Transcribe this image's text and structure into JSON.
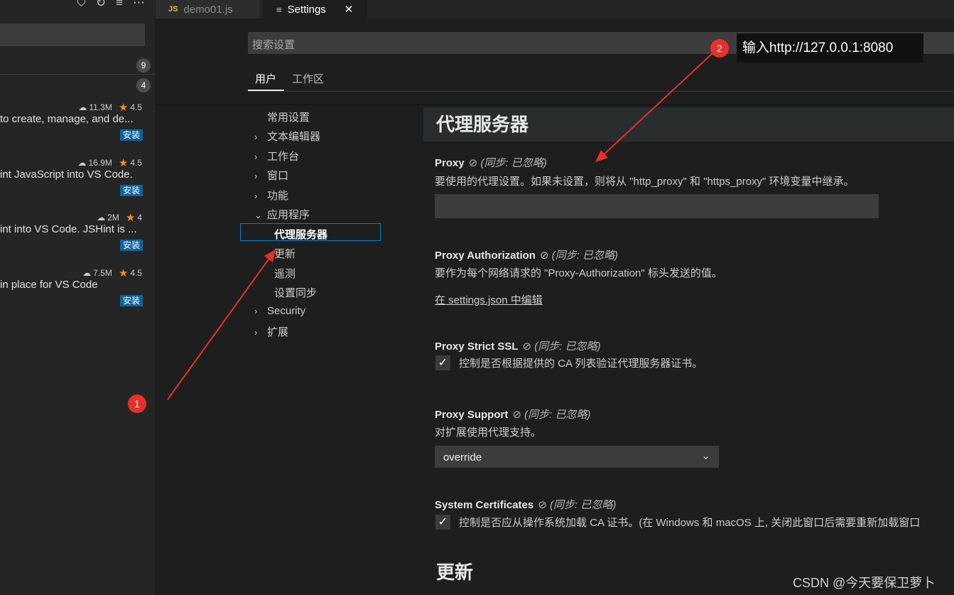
{
  "tabs": [
    {
      "label": "demo01.js",
      "icon": "js-icon",
      "icon_text": "JS"
    },
    {
      "label": "Settings",
      "icon": "settings-doc-icon",
      "close": "✕"
    }
  ],
  "sidebar": {
    "view_count_1": "9",
    "view_count_2": "4",
    "extensions": [
      {
        "downloads": "11.3M",
        "rating": "4.5",
        "description": "to create, manage, and de...",
        "install": "安装"
      },
      {
        "downloads": "16.9M",
        "rating": "4.5",
        "description": "int JavaScript into VS Code.",
        "install": "安装"
      },
      {
        "downloads": "2M",
        "rating": "4",
        "description": "int into VS Code. JSHint is ...",
        "install": "安装"
      },
      {
        "downloads": "7.5M",
        "rating": "4.5",
        "description": "in place for VS Code",
        "install": "安装"
      }
    ]
  },
  "settings": {
    "search_placeholder": "搜索设置",
    "scope_tabs": [
      "用户",
      "工作区"
    ],
    "toc": [
      {
        "label": "常用设置",
        "chevron": ""
      },
      {
        "label": "文本编辑器",
        "chevron": "›"
      },
      {
        "label": "工作台",
        "chevron": "›"
      },
      {
        "label": "窗口",
        "chevron": "›"
      },
      {
        "label": "功能",
        "chevron": "›"
      },
      {
        "label": "应用程序",
        "chevron": "⌄"
      },
      {
        "label": "代理服务器",
        "chevron": ""
      },
      {
        "label": "更新",
        "chevron": ""
      },
      {
        "label": "遥测",
        "chevron": ""
      },
      {
        "label": "设置同步",
        "chevron": ""
      },
      {
        "label": "Security",
        "chevron": "›"
      },
      {
        "label": "扩展",
        "chevron": "›"
      }
    ],
    "section_title": "代理服务器",
    "sync_note": "(同步: 已忽略)",
    "items": [
      {
        "title": "Proxy",
        "description": "要使用的代理设置。如果未设置，则将从 \"http_proxy\" 和 \"https_proxy\" 环境变量中继承。"
      },
      {
        "title": "Proxy Authorization",
        "description": "要作为每个网络请求的 \"Proxy-Authorization\" 标头发送的值。",
        "link": "在 settings.json 中编辑"
      },
      {
        "title": "Proxy Strict SSL",
        "description": "控制是否根据提供的 CA 列表验证代理服务器证书。",
        "checked": "✓"
      },
      {
        "title": "Proxy Support",
        "description": "对扩展使用代理支持。",
        "select_value": "override"
      },
      {
        "title": "System Certificates",
        "description": "控制是否应从操作系统加载 CA 证书。(在 Windows 和 macOS 上, 关闭此窗口后需要重新加载窗口",
        "checked": "✓"
      }
    ],
    "next_section": "更新"
  },
  "annotations": {
    "badge1": "1",
    "badge2": "2",
    "tooltip": "输入http://127.0.0.1:8080",
    "watermark": "CSDN @今天要保卫萝卜"
  },
  "colors": {
    "accent": "#007fd4",
    "install_button": "#0e639c",
    "star": "#ff8e00",
    "annotation_red": "#e8302b"
  }
}
